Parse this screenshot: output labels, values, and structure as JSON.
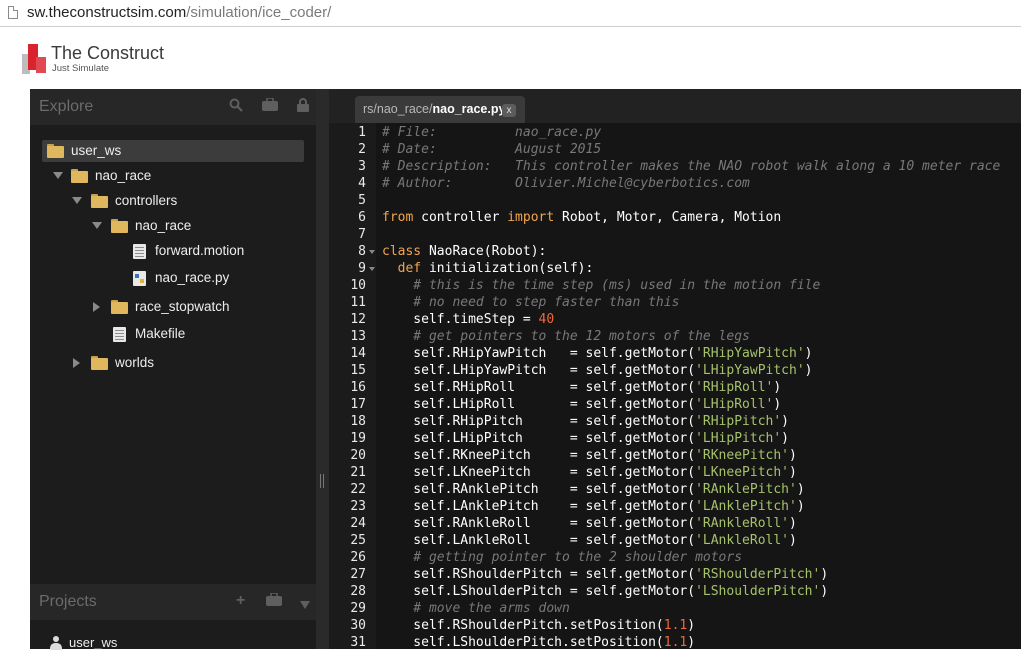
{
  "browser": {
    "url_domain": "sw.theconstructsim.com",
    "url_path": "/simulation/ice_coder/"
  },
  "site": {
    "brand_name": "The Construct",
    "tagline": "Just Simulate"
  },
  "explorer": {
    "title": "Explore",
    "icons": [
      "search-icon",
      "briefcase-icon",
      "lock-icon"
    ],
    "tree": {
      "user_ws": "user_ws",
      "nao_race": "nao_race",
      "controllers": "controllers",
      "nao_race_sub": "nao_race",
      "forward_motion": "forward.motion",
      "nao_race_py": "nao_race.py",
      "race_stopwatch": "race_stopwatch",
      "makefile": "Makefile",
      "worlds": "worlds"
    }
  },
  "projects": {
    "title": "Projects",
    "icons": [
      "plus-icon",
      "briefcase-icon",
      "chevron-down-icon"
    ],
    "item": "user_ws"
  },
  "editor": {
    "tab_path": "rs/nao_race/",
    "tab_file": "nao_race.py",
    "tab_close": "x",
    "line_numbers": [
      "1",
      "2",
      "3",
      "4",
      "5",
      "6",
      "7",
      "8",
      "9",
      "10",
      "11",
      "12",
      "13",
      "14",
      "15",
      "16",
      "17",
      "18",
      "19",
      "20",
      "21",
      "22",
      "23",
      "24",
      "25",
      "26",
      "27",
      "28",
      "29",
      "30",
      "31"
    ],
    "code": {
      "l1": "# File:          nao_race.py",
      "l2": "# Date:          August 2015",
      "l3": "# Description:   This controller makes the NAO robot walk along a 10 meter race",
      "l4": "# Author:        Olivier.Michel@cyberbotics.com",
      "l6_kw1": "from",
      "l6_mid": " controller ",
      "l6_kw2": "import",
      "l6_rest": " Robot, Motor, Camera, Motion",
      "l8_kw": "class",
      "l8_rest": " NaoRace(Robot):",
      "l9_kw": "  def",
      "l9_rest": " initialization(self):",
      "l10": "    # this is the time step (ms) used in the motion file",
      "l11": "    # no need to step faster than this",
      "l12_a": "    self.timeStep = ",
      "l12_num": "40",
      "l13": "    # get pointers to the 12 motors of the legs",
      "l14_a": "    self.RHipYawPitch   = self.getMotor(",
      "l14_s": "'RHipYawPitch'",
      "l14_b": ")",
      "l15_a": "    self.LHipYawPitch   = self.getMotor(",
      "l15_s": "'LHipYawPitch'",
      "l15_b": ")",
      "l16_a": "    self.RHipRoll       = self.getMotor(",
      "l16_s": "'RHipRoll'",
      "l16_b": ")",
      "l17_a": "    self.LHipRoll       = self.getMotor(",
      "l17_s": "'LHipRoll'",
      "l17_b": ")",
      "l18_a": "    self.RHipPitch      = self.getMotor(",
      "l18_s": "'RHipPitch'",
      "l18_b": ")",
      "l19_a": "    self.LHipPitch      = self.getMotor(",
      "l19_s": "'LHipPitch'",
      "l19_b": ")",
      "l20_a": "    self.RKneePitch     = self.getMotor(",
      "l20_s": "'RKneePitch'",
      "l20_b": ")",
      "l21_a": "    self.LKneePitch     = self.getMotor(",
      "l21_s": "'LKneePitch'",
      "l21_b": ")",
      "l22_a": "    self.RAnklePitch    = self.getMotor(",
      "l22_s": "'RAnklePitch'",
      "l22_b": ")",
      "l23_a": "    self.LAnklePitch    = self.getMotor(",
      "l23_s": "'LAnklePitch'",
      "l23_b": ")",
      "l24_a": "    self.RAnkleRoll     = self.getMotor(",
      "l24_s": "'RAnkleRoll'",
      "l24_b": ")",
      "l25_a": "    self.LAnkleRoll     = self.getMotor(",
      "l25_s": "'LAnkleRoll'",
      "l25_b": ")",
      "l26": "    # getting pointer to the 2 shoulder motors",
      "l27_a": "    self.RShoulderPitch = self.getMotor(",
      "l27_s": "'RShoulderPitch'",
      "l27_b": ")",
      "l28_a": "    self.LShoulderPitch = self.getMotor(",
      "l28_s": "'LShoulderPitch'",
      "l28_b": ")",
      "l29": "    # move the arms down",
      "l30_a": "    self.RShoulderPitch.setPosition(",
      "l30_n": "1.1",
      "l30_b": ")",
      "l31_a": "    self.LShoulderPitch.setPosition(",
      "l31_n": "1.1",
      "l31_b": ")"
    }
  },
  "colors": {
    "editor_bg": "#151515",
    "keyword": "#f3a54d",
    "string": "#a6c26a",
    "number": "#f0673c",
    "comment": "#787878",
    "folder": "#e1b75d",
    "brand_red": "#d9232d"
  }
}
